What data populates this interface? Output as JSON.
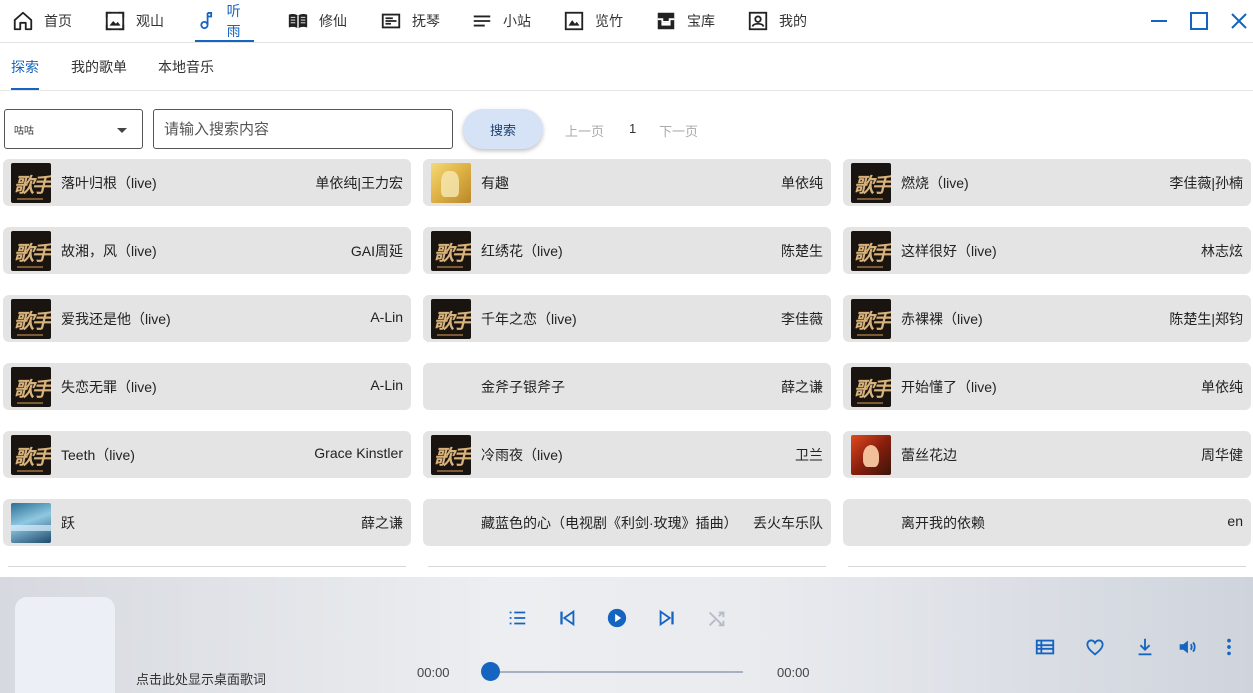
{
  "nav": {
    "items": [
      {
        "label": "首页",
        "icon": "home-icon"
      },
      {
        "label": "观山",
        "icon": "image-frame-icon"
      },
      {
        "label": "听雨",
        "icon": "music-note-icon",
        "active": true
      },
      {
        "label": "修仙",
        "icon": "open-book-icon"
      },
      {
        "label": "抚琴",
        "icon": "article-icon"
      },
      {
        "label": "小站",
        "icon": "lines-icon"
      },
      {
        "label": "览竹",
        "icon": "picture-icon"
      },
      {
        "label": "宝库",
        "icon": "inbox-icon"
      },
      {
        "label": "我的",
        "icon": "user-card-icon"
      }
    ]
  },
  "window": {
    "minimize": "minimize-icon",
    "maximize": "maximize-icon",
    "close": "close-icon"
  },
  "subtabs": [
    {
      "label": "探索",
      "active": true
    },
    {
      "label": "我的歌单"
    },
    {
      "label": "本地音乐"
    }
  ],
  "search": {
    "source_value": "咕咕",
    "placeholder": "请输入搜索内容",
    "button_label": "搜索",
    "prev_label": "上一页",
    "page": "1",
    "next_label": "下一页"
  },
  "songs": [
    {
      "title": "落叶归根（live)",
      "artist": "单依纯|王力宏",
      "cover": "geshou"
    },
    {
      "title": "有趣",
      "artist": "单依纯",
      "cover": "youqu"
    },
    {
      "title": "燃烧（live)",
      "artist": "李佳薇|孙楠",
      "cover": "geshou"
    },
    {
      "title": "故湘，风（live)",
      "artist": "GAI周延",
      "cover": "geshou"
    },
    {
      "title": "红绣花（live)",
      "artist": "陈楚生",
      "cover": "geshou"
    },
    {
      "title": "这样很好（live)",
      "artist": "林志炫",
      "cover": "geshou"
    },
    {
      "title": "爱我还是他（live)",
      "artist": "A-Lin",
      "cover": "geshou"
    },
    {
      "title": "千年之恋（live)",
      "artist": "李佳薇",
      "cover": "geshou"
    },
    {
      "title": "赤裸裸（live)",
      "artist": "陈楚生|郑钧",
      "cover": "geshou"
    },
    {
      "title": "失恋无罪（live)",
      "artist": "A-Lin",
      "cover": "geshou"
    },
    {
      "title": "金斧子银斧子",
      "artist": "薛之谦",
      "cover": "none"
    },
    {
      "title": "开始懂了（live)",
      "artist": "单依纯",
      "cover": "geshou"
    },
    {
      "title": "Teeth（live)",
      "artist": "Grace Kinstler",
      "cover": "geshou"
    },
    {
      "title": "冷雨夜（live)",
      "artist": "卫兰",
      "cover": "geshou"
    },
    {
      "title": "蕾丝花边",
      "artist": "周华健",
      "cover": "lace"
    },
    {
      "title": "跃",
      "artist": "薛之谦",
      "cover": "yue"
    },
    {
      "title": "藏蓝色的心（电视剧《利剑·玫瑰》插曲）",
      "artist": "丢火车乐队",
      "cover": "none"
    },
    {
      "title": "离开我的依赖",
      "artist": "en",
      "cover": "none"
    }
  ],
  "player": {
    "lyric_hint": "点击此处显示桌面歌词",
    "current_time": "00:00",
    "total_time": "00:00",
    "progress": 0,
    "accent": "#1565c0"
  }
}
